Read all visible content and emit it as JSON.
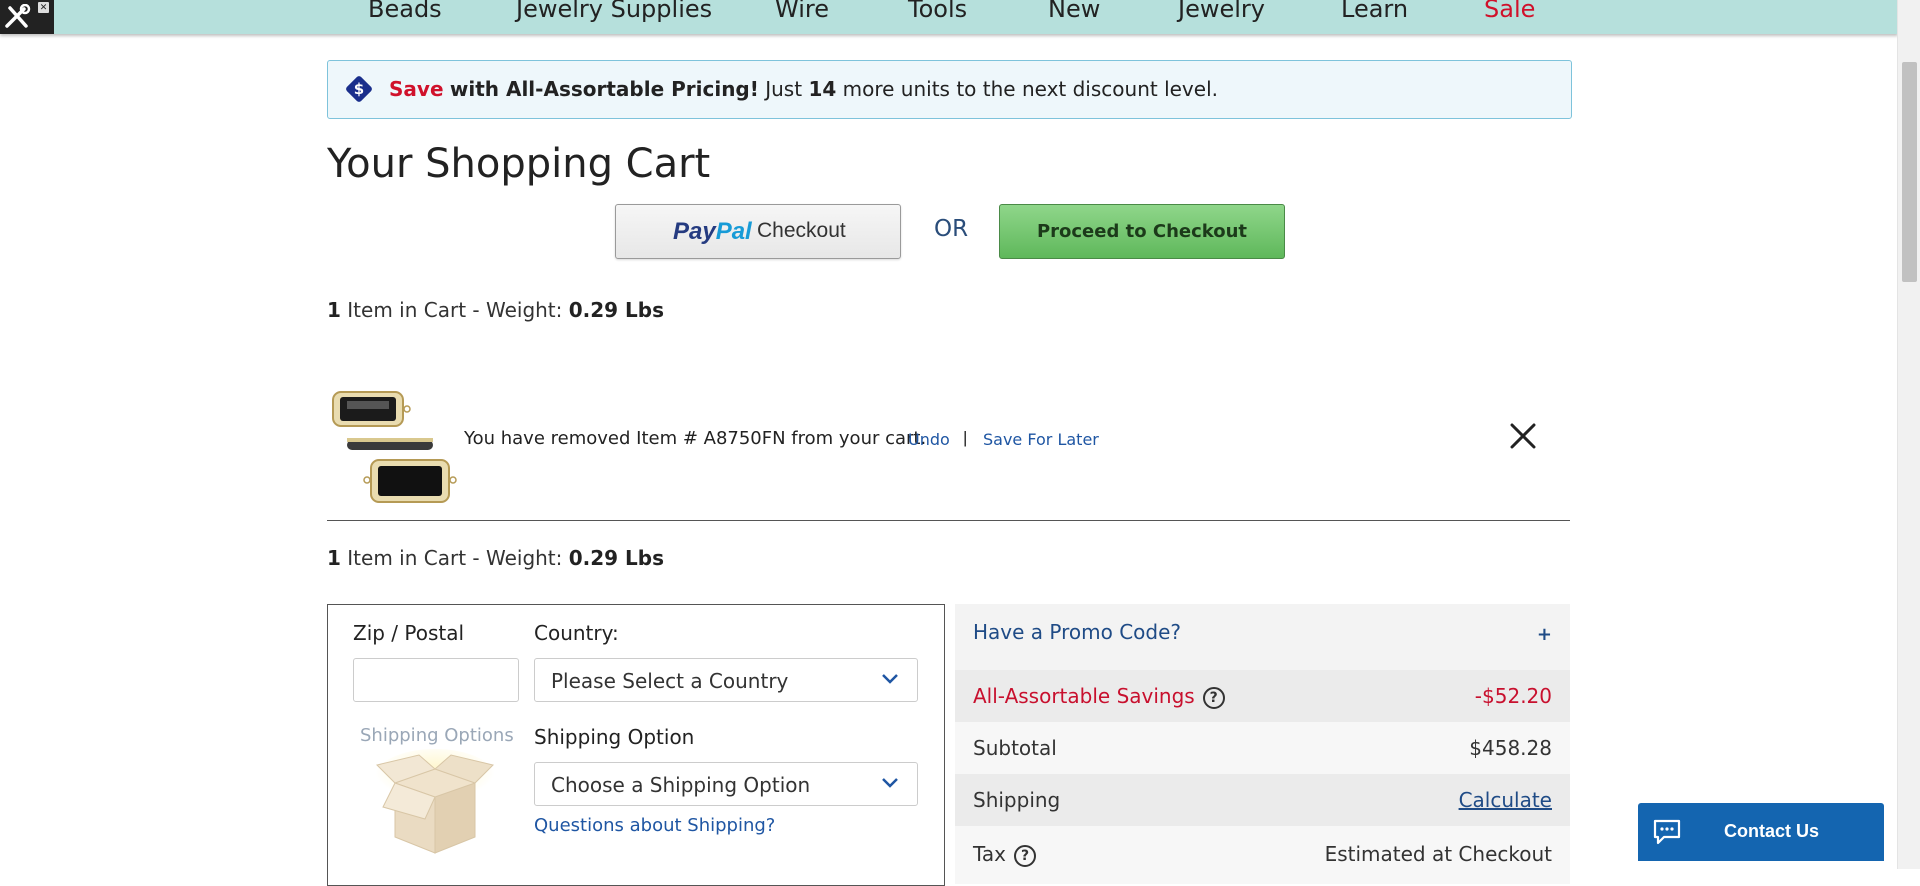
{
  "nav": {
    "items": [
      {
        "label": "Beads",
        "sale": false
      },
      {
        "label": "Jewelry Supplies",
        "sale": false
      },
      {
        "label": "Wire",
        "sale": false
      },
      {
        "label": "Tools",
        "sale": false
      },
      {
        "label": "New",
        "sale": false
      },
      {
        "label": "Jewelry",
        "sale": false
      },
      {
        "label": "Learn",
        "sale": false
      },
      {
        "label": "Sale",
        "sale": true
      }
    ]
  },
  "banner": {
    "save_word": "Save",
    "bold_text": "with All-Assortable Pricing!",
    "just_text": "Just",
    "units": "14",
    "rest_text": "more units to the next discount level."
  },
  "page_title": "Your Shopping Cart",
  "buttons": {
    "paypal_pay": "Pay",
    "paypal_pal": "Pal",
    "paypal_checkout": "Checkout",
    "or_text": "OR",
    "proceed_checkout": "Proceed to Checkout"
  },
  "cart_summary_top": {
    "count": "1",
    "text": "Item in Cart - Weight:",
    "weight": "0.29 Lbs"
  },
  "removed": {
    "message": "You have removed Item # A8750FN from your cart.",
    "undo": "Undo",
    "separator": "|",
    "save_for_later": "Save For Later"
  },
  "cart_summary_bottom": {
    "count": "1",
    "text": "Item in Cart - Weight:",
    "weight": "0.29 Lbs"
  },
  "shipping": {
    "zip_label": "Zip / Postal",
    "zip_value": "",
    "country_label": "Country:",
    "country_selected": "Please Select a Country",
    "image_label": "Shipping Options",
    "option_label": "Shipping Option",
    "option_selected": "Choose a Shipping Option",
    "questions_link": "Questions about Shipping?"
  },
  "summary": {
    "promo_label": "Have a Promo Code?",
    "promo_toggle": "+",
    "savings_label": "All-Assortable Savings",
    "savings_value": "-$52.20",
    "subtotal_label": "Subtotal",
    "subtotal_value": "$458.28",
    "shipping_label": "Shipping",
    "shipping_value": "Calculate",
    "tax_label": "Tax",
    "tax_value": "Estimated at Checkout",
    "help_glyph": "?"
  },
  "contact": {
    "label": "Contact Us"
  },
  "colors": {
    "nav_bg": "#b6e0dc",
    "sale_red": "#d0112b",
    "link_blue": "#1f56a3",
    "checkout_green": "#5fb85b",
    "contact_blue": "#1465b0"
  }
}
